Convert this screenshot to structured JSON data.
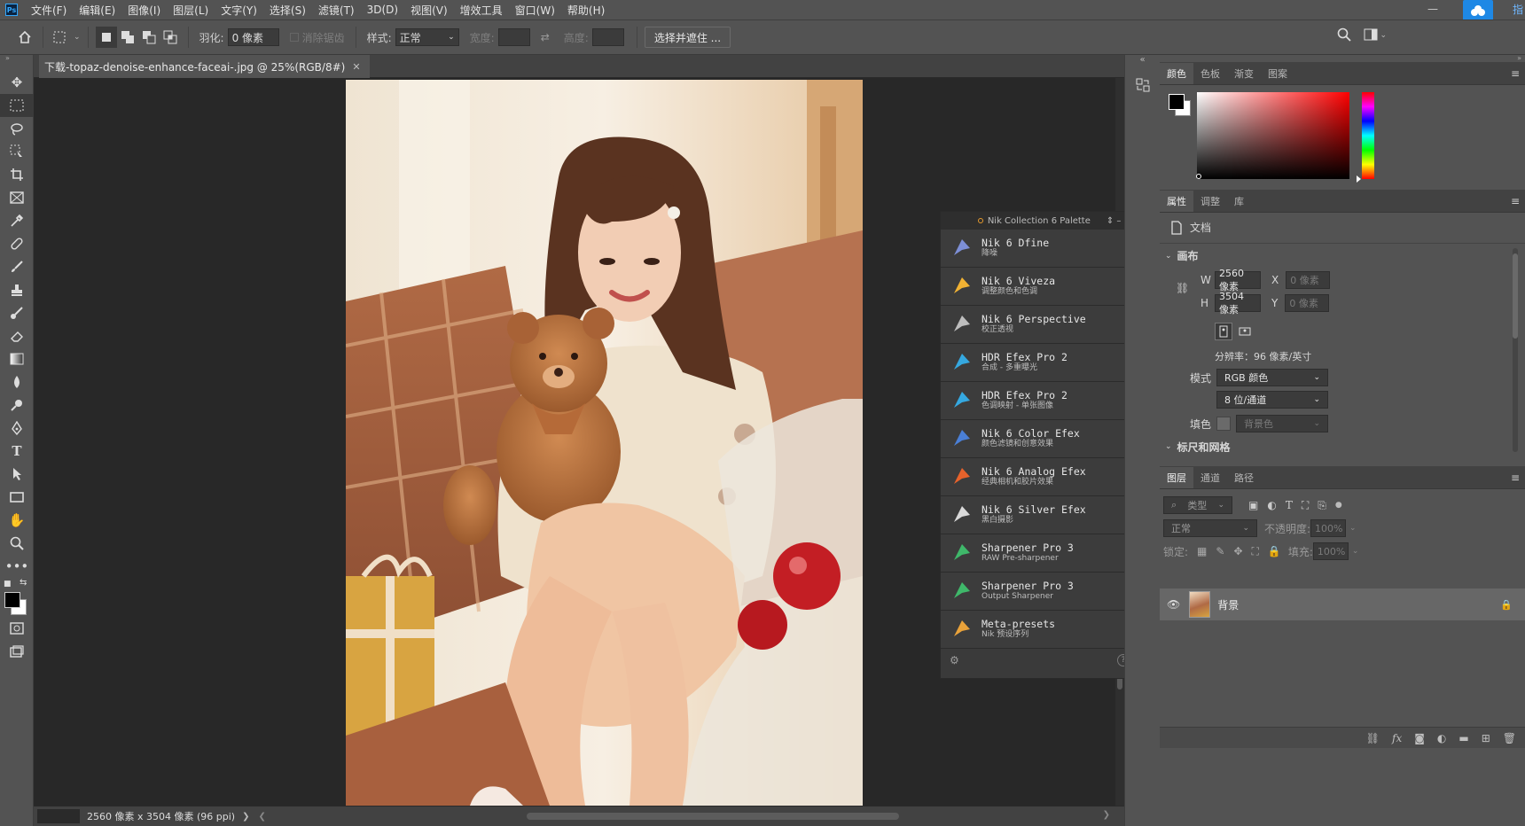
{
  "menubar": {
    "logo": "Ps",
    "items": [
      "文件(F)",
      "编辑(E)",
      "图像(I)",
      "图层(L)",
      "文字(Y)",
      "选择(S)",
      "滤镜(T)",
      "3D(D)",
      "视图(V)",
      "增效工具",
      "窗口(W)",
      "帮助(H)"
    ],
    "tray_text": "指"
  },
  "options": {
    "feather_label": "羽化:",
    "feather_value": "0 像素",
    "antialias_label": "消除锯齿",
    "style_label": "样式:",
    "style_value": "正常",
    "width_label": "宽度:",
    "height_label": "高度:",
    "select_mask_button": "选择并遮住 ..."
  },
  "document": {
    "tab_title": "下载-topaz-denoise-enhance-faceai-.jpg @ 25%(RGB/8#)",
    "status": "2560 像素 x 3504 像素 (96 ppi)"
  },
  "nik_palette": {
    "title": "Nik Collection 6 Palette",
    "items": [
      {
        "name": "Nik 6 Dfine",
        "sub": "降噪",
        "color": "#7d8fd6"
      },
      {
        "name": "Nik 6 Viveza",
        "sub": "调整颜色和色调",
        "color": "#f1b233"
      },
      {
        "name": "Nik 6 Perspective",
        "sub": "校正透视",
        "color": "#bdbdbd"
      },
      {
        "name": "HDR Efex Pro 2",
        "sub": "合成 - 多重曝光",
        "color": "#35a8e0"
      },
      {
        "name": "HDR Efex Pro 2",
        "sub": "色调映射 - 单张图像",
        "color": "#35a8e0"
      },
      {
        "name": "Nik 6 Color Efex",
        "sub": "颜色滤镜和创意效果",
        "color": "#4a7fd6"
      },
      {
        "name": "Nik 6 Analog Efex",
        "sub": "经典相机和胶片效果",
        "color": "#e7622b"
      },
      {
        "name": "Nik 6 Silver Efex",
        "sub": "黑白摄影",
        "color": "#d9d9d9"
      },
      {
        "name": "Sharpener Pro 3",
        "sub": "RAW Pre-sharpener",
        "color": "#3fb86a"
      },
      {
        "name": "Sharpener Pro 3",
        "sub": "Output Sharpener",
        "color": "#3fb86a"
      },
      {
        "name": "Meta-presets",
        "sub": "Nik 预设序列",
        "color": "#e9a23a"
      }
    ],
    "help": "?"
  },
  "color_panel": {
    "tabs": [
      "颜色",
      "色板",
      "渐变",
      "图案"
    ]
  },
  "properties_panel": {
    "tabs": [
      "属性",
      "调整",
      "库"
    ],
    "doc_label": "文档",
    "section": "画布",
    "w_label": "W",
    "w_value": "2560 像素",
    "h_label": "H",
    "h_value": "3504 像素",
    "x_label": "X",
    "x_value": "0 像素",
    "y_label": "Y",
    "y_value": "0 像素",
    "resolution": "分辨率：96 像素/英寸",
    "mode_label": "模式",
    "mode_value": "RGB 颜色",
    "depth_value": "8 位/通道",
    "fill_label": "填色",
    "fill_value": "背景色",
    "next_section": "标尺和网格"
  },
  "layers_panel": {
    "tabs": [
      "图层",
      "通道",
      "路径"
    ],
    "filter_placeholder": "类型",
    "blend_mode": "正常",
    "opacity_label": "不透明度:",
    "opacity_value": "100%",
    "lock_label": "锁定:",
    "fill_label": "填充:",
    "fill_value": "100%",
    "layer_name": "背景"
  }
}
